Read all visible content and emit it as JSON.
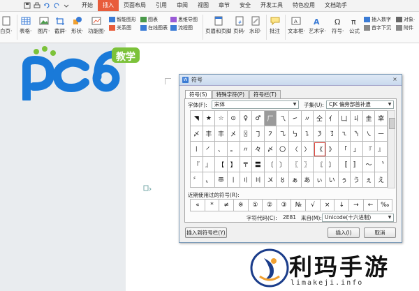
{
  "menu": {
    "items": [
      "开始",
      "插入",
      "页面布局",
      "引用",
      "审阅",
      "视图",
      "章节",
      "安全",
      "开发工具",
      "特色应用",
      "文档助手"
    ],
    "active_index": 1
  },
  "ribbon": {
    "big": [
      {
        "label": "白页·",
        "icon": "blank-page-icon"
      },
      {
        "label": "表格·",
        "icon": "table-icon"
      },
      {
        "label": "图片·",
        "icon": "picture-icon"
      },
      {
        "label": "截屏·",
        "icon": "screenshot-icon"
      },
      {
        "label": "形状·",
        "icon": "shape-icon"
      },
      {
        "label": "功能图·",
        "icon": "function-chart-icon"
      },
      {
        "label": "页眉和页脚",
        "icon": "header-footer-icon"
      },
      {
        "label": "页码·",
        "icon": "page-number-icon"
      },
      {
        "label": "水印·",
        "icon": "watermark-icon"
      },
      {
        "label": "批注",
        "icon": "comment-icon"
      },
      {
        "label": "文本框·",
        "icon": "textbox-icon"
      },
      {
        "label": "艺术字·",
        "icon": "wordart-icon"
      },
      {
        "label": "符号·",
        "icon": "symbol-icon"
      },
      {
        "label": "公式",
        "icon": "formula-icon"
      }
    ],
    "small": {
      "smart_shape": "智能图形",
      "chart": "图表",
      "mind_map": "思维导图",
      "relation": "关系图",
      "online_chart": "在线图表",
      "flowchart": "流程图",
      "insert_number": "插入数字",
      "object": "对象·",
      "first_letter": "首字下沉",
      "annex": "附件",
      "omega": "Ω",
      "pi": "π"
    }
  },
  "logo": {
    "text": "pc6",
    "badge": "教学"
  },
  "dialog": {
    "title": "符号",
    "close": "×",
    "tabs": [
      "符号(S)",
      "特殊字符(P)",
      "符号栏(T)"
    ],
    "font_label": "字体(F):",
    "font_value": "宋体",
    "subset_label": "子集(U):",
    "subset_value": "CJK 偏旁部首补遗",
    "grid": [
      [
        "◥",
        "★",
        "☆",
        "⊙",
        "♀",
        "♂",
        "厂",
        "乁",
        "㇀",
        "〃",
        "仝",
        "亻",
        "凵",
        "丩",
        "圭",
        "丵"
      ],
      [
        "〆",
        "丰",
        "丰",
        "㐅",
        "〿",
        "㇆",
        "㇇",
        "㇈",
        "㇉",
        "㇊",
        "㇋",
        "㇌",
        "㇍",
        "㇎",
        "㇏",
        "㇐"
      ],
      [
        "㇑",
        "㇒",
        "、",
        "。",
        "〃",
        "々",
        "〆",
        "〇",
        "〈",
        "〉",
        "《",
        "》",
        "「",
        "」",
        "『",
        "』"
      ],
      [
        "『",
        "』",
        "【",
        "】",
        "〒",
        "〓",
        "〔",
        "〕",
        "〖",
        "〗",
        "〘",
        "〙",
        "〚",
        "〛",
        "〜",
        "〝"
      ],
      [
        "〞",
        "〟",
        "〠",
        "〡",
        "〢",
        "〣",
        "〤",
        "〥",
        "ぁ",
        "あ",
        "ぃ",
        "い",
        "ぅ",
        "う",
        "ぇ",
        "え"
      ]
    ],
    "highlight": {
      "row": 2,
      "col": 10
    },
    "dark": {
      "row": 0,
      "col": 6
    },
    "recent_label": "近期使用过的符号(R):",
    "recent": [
      "«",
      "*",
      "≠",
      "※",
      "①",
      "②",
      "③",
      "№",
      "√",
      "×",
      "↓",
      "→",
      "←",
      "‰"
    ],
    "char_code_label": "字符代码(C):",
    "char_code_value": "2E81",
    "from_label": "来自(M):",
    "from_value": "Unicode(十六进制)",
    "btn_symbol_bar": "插入到符号栏(Y)",
    "btn_insert": "插入(I)",
    "btn_cancel": "取消"
  },
  "watermark": {
    "text": "利玛手游",
    "sub": "limakeji.info"
  }
}
